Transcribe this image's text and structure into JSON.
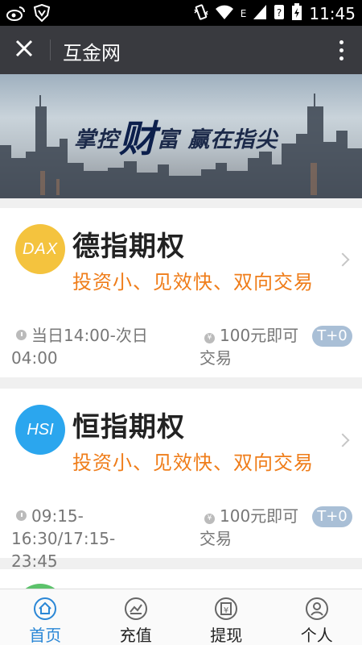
{
  "status_bar": {
    "time": "11:45",
    "network": "E",
    "icons": [
      "weibo-icon",
      "shield-icon",
      "vibrate-icon",
      "wifi-icon",
      "signal-icon",
      "sim-icon",
      "battery-icon"
    ]
  },
  "title_bar": {
    "title": "互金网",
    "close_icon": "close-icon",
    "more_icon": "more-vertical-icon"
  },
  "banner": {
    "slogan_part1": "掌控",
    "slogan_big": "财",
    "slogan_part2": "富 赢在指尖"
  },
  "products": [
    {
      "logo": "DAX",
      "logo_color": "#f4c33e",
      "title": "德指期权",
      "subtitle": "投资小、见效快、双向交易",
      "time_line1": "当日14:00-次日",
      "time_line2": "04:00",
      "amount_line1": "100元即可",
      "amount_line2": "交易",
      "badge": "T+0"
    },
    {
      "logo": "HSI",
      "logo_color": "#2ba6ee",
      "title": "恒指期权",
      "subtitle": "投资小、见效快、双向交易",
      "time_line1": "09:15-16:30/17:15-",
      "time_line2": "23:45",
      "amount_line1": "100元即可",
      "amount_line2": "交易",
      "badge": "T+0"
    }
  ],
  "bottom_nav": {
    "items": [
      {
        "label": "首页",
        "icon": "home-icon",
        "active": true
      },
      {
        "label": "充值",
        "icon": "recharge-icon",
        "active": false
      },
      {
        "label": "提现",
        "icon": "withdraw-icon",
        "active": false
      },
      {
        "label": "个人",
        "icon": "user-icon",
        "active": false
      }
    ]
  },
  "colors": {
    "accent": "#2a87d6",
    "subtitle_orange": "#ef7d1a",
    "titlebar_bg": "#393a3f",
    "badge_bg": "#a9bfd6"
  }
}
